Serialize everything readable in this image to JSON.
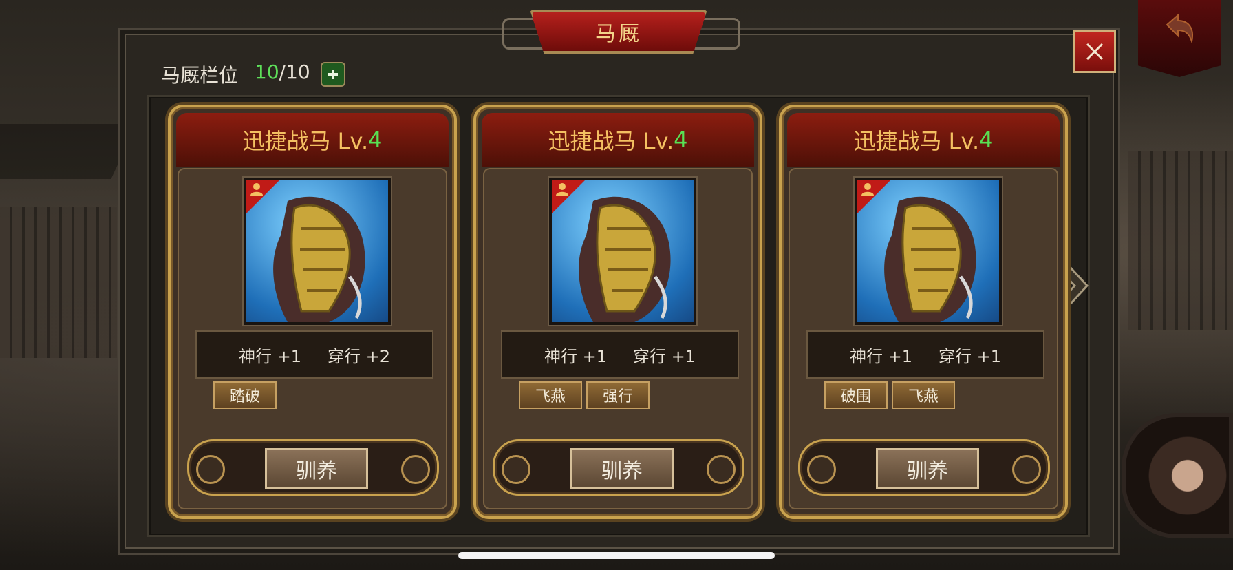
{
  "window": {
    "title": "马厩",
    "close_icon": "close-icon"
  },
  "stable": {
    "label": "马厩栏位",
    "current": "10",
    "separator": "/",
    "max": "10"
  },
  "cards": [
    {
      "name": "迅捷战马 Lv.",
      "level": "4",
      "stat1": "神行 +1",
      "stat2": "穿行 +2",
      "skills": [
        "踏破"
      ],
      "button": "驯养"
    },
    {
      "name": "迅捷战马 Lv.",
      "level": "4",
      "stat1": "神行 +1",
      "stat2": "穿行 +1",
      "skills": [
        "飞燕",
        "强行"
      ],
      "button": "驯养"
    },
    {
      "name": "迅捷战马 Lv.",
      "level": "4",
      "stat1": "神行 +1",
      "stat2": "穿行 +1",
      "skills": [
        "破围",
        "飞燕"
      ],
      "button": "驯养"
    }
  ],
  "colors": {
    "accent_gold": "#c9a24e",
    "level_green": "#58e254",
    "title_red": "#8c1d10"
  }
}
